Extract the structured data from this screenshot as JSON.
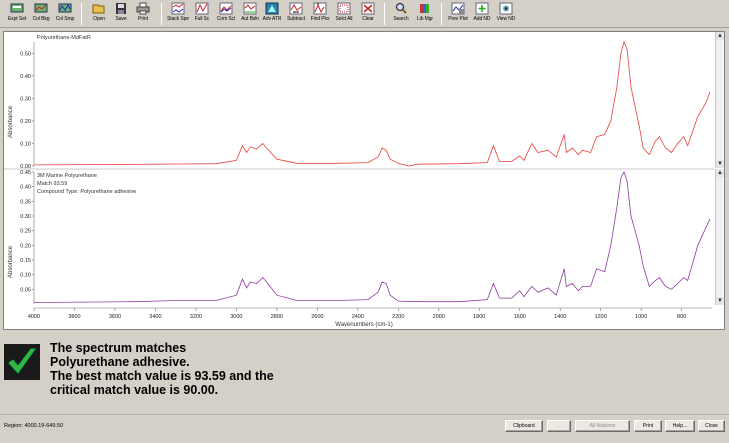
{
  "toolbar": {
    "buttons": [
      {
        "label": "Expt Set",
        "icon": "expt-set-icon"
      },
      {
        "label": "Col Bkg",
        "icon": "collect-background-icon"
      },
      {
        "label": "Col Smp",
        "icon": "collect-sample-icon"
      },
      {
        "label": "Open",
        "icon": "open-folder-icon"
      },
      {
        "label": "Save",
        "icon": "save-disk-icon"
      },
      {
        "label": "Print",
        "icon": "printer-icon"
      },
      {
        "label": "Stack Spe",
        "icon": "stack-spectra-icon"
      },
      {
        "label": "Full Sc",
        "icon": "full-scale-icon"
      },
      {
        "label": "Com Scl",
        "icon": "common-scale-icon"
      },
      {
        "label": "Aut Bsln",
        "icon": "auto-baseline-icon"
      },
      {
        "label": "Adv ATR",
        "icon": "advanced-atr-icon"
      },
      {
        "label": "Subtract",
        "icon": "subtract-icon"
      },
      {
        "label": "Find Pks",
        "icon": "find-peaks-icon"
      },
      {
        "label": "Selct All",
        "icon": "select-all-icon"
      },
      {
        "label": "Clear",
        "icon": "clear-icon"
      },
      {
        "label": "Search",
        "icon": "search-icon"
      },
      {
        "label": "Lib Mgr",
        "icon": "library-manager-icon"
      },
      {
        "label": "Prev Plot",
        "icon": "preview-plot-icon"
      },
      {
        "label": "Add ND",
        "icon": "add-nd-icon"
      },
      {
        "label": "View ND",
        "icon": "view-nd-icon"
      }
    ]
  },
  "plot": {
    "upper_label": "Polyurethane-MdFatR",
    "lower_label": "3M Marine Polyurethane",
    "match_line": "Match 93.59",
    "compound_line": "Compound Type:  Polyurethane adhesive",
    "y_axis_label": "Absorbance",
    "x_axis_label": "Wavenumbers (cm-1)",
    "upper_color": "#e8423c",
    "lower_color": "#8e3aa0"
  },
  "chart_data": [
    {
      "type": "line",
      "title": "Polyurethane-MdFatR",
      "xlabel": "Wavenumbers (cm-1)",
      "ylabel": "Absorbance",
      "xlim": [
        4000,
        650
      ],
      "ylim": [
        0,
        0.55
      ],
      "yticks": [
        "0.00",
        "0.10",
        "0.20",
        "0.30",
        "0.40",
        "0.50"
      ],
      "series": [
        {
          "name": "Polyurethane-MdFatR",
          "color": "#e8423c",
          "points": [
            [
              4000,
              0.005
            ],
            [
              3500,
              0.007
            ],
            [
              3400,
              0.008
            ],
            [
              3300,
              0.009
            ],
            [
              3100,
              0.01
            ],
            [
              3000,
              0.025
            ],
            [
              2970,
              0.09
            ],
            [
              2950,
              0.06
            ],
            [
              2930,
              0.085
            ],
            [
              2900,
              0.075
            ],
            [
              2870,
              0.1
            ],
            [
              2850,
              0.08
            ],
            [
              2800,
              0.03
            ],
            [
              2700,
              0.012
            ],
            [
              2500,
              0.012
            ],
            [
              2350,
              0.015
            ],
            [
              2300,
              0.04
            ],
            [
              2280,
              0.08
            ],
            [
              2260,
              0.07
            ],
            [
              2240,
              0.03
            ],
            [
              2200,
              0.012
            ],
            [
              2150,
              0.0
            ],
            [
              2100,
              0.008
            ],
            [
              1900,
              0.01
            ],
            [
              1760,
              0.015
            ],
            [
              1730,
              0.09
            ],
            [
              1700,
              0.02
            ],
            [
              1640,
              0.02
            ],
            [
              1600,
              0.045
            ],
            [
              1580,
              0.025
            ],
            [
              1540,
              0.1
            ],
            [
              1510,
              0.06
            ],
            [
              1460,
              0.07
            ],
            [
              1420,
              0.04
            ],
            [
              1380,
              0.14
            ],
            [
              1370,
              0.06
            ],
            [
              1340,
              0.08
            ],
            [
              1310,
              0.05
            ],
            [
              1290,
              0.07
            ],
            [
              1250,
              0.06
            ],
            [
              1220,
              0.13
            ],
            [
              1180,
              0.14
            ],
            [
              1150,
              0.2
            ],
            [
              1120,
              0.35
            ],
            [
              1100,
              0.5
            ],
            [
              1085,
              0.55
            ],
            [
              1070,
              0.52
            ],
            [
              1050,
              0.35
            ],
            [
              1010,
              0.18
            ],
            [
              990,
              0.08
            ],
            [
              960,
              0.05
            ],
            [
              930,
              0.11
            ],
            [
              910,
              0.13
            ],
            [
              880,
              0.08
            ],
            [
              850,
              0.06
            ],
            [
              820,
              0.1
            ],
            [
              790,
              0.13
            ],
            [
              770,
              0.09
            ],
            [
              720,
              0.22
            ],
            [
              680,
              0.28
            ],
            [
              660,
              0.33
            ]
          ]
        }
      ]
    },
    {
      "type": "line",
      "title": "3M Marine Polyurethane",
      "xlabel": "Wavenumbers (cm-1)",
      "ylabel": "Absorbance",
      "xlim": [
        4000,
        650
      ],
      "ylim": [
        0,
        0.45
      ],
      "yticks": [
        "0.05",
        "0.10",
        "0.15",
        "0.20",
        "0.25",
        "0.30",
        "0.35",
        "0.40",
        "0.45"
      ],
      "series": [
        {
          "name": "3M Marine Polyurethane",
          "color": "#8e3aa0",
          "points": [
            [
              4000,
              0.005
            ],
            [
              3500,
              0.008
            ],
            [
              3400,
              0.01
            ],
            [
              3300,
              0.012
            ],
            [
              3100,
              0.012
            ],
            [
              3000,
              0.03
            ],
            [
              2970,
              0.085
            ],
            [
              2950,
              0.055
            ],
            [
              2930,
              0.075
            ],
            [
              2900,
              0.07
            ],
            [
              2870,
              0.09
            ],
            [
              2850,
              0.075
            ],
            [
              2800,
              0.03
            ],
            [
              2700,
              0.012
            ],
            [
              2500,
              0.012
            ],
            [
              2350,
              0.015
            ],
            [
              2300,
              0.04
            ],
            [
              2280,
              0.075
            ],
            [
              2260,
              0.07
            ],
            [
              2240,
              0.03
            ],
            [
              2200,
              0.01
            ],
            [
              2100,
              0.008
            ],
            [
              1900,
              0.008
            ],
            [
              1760,
              0.015
            ],
            [
              1730,
              0.07
            ],
            [
              1700,
              0.02
            ],
            [
              1640,
              0.02
            ],
            [
              1600,
              0.045
            ],
            [
              1580,
              0.025
            ],
            [
              1540,
              0.06
            ],
            [
              1510,
              0.04
            ],
            [
              1460,
              0.055
            ],
            [
              1420,
              0.03
            ],
            [
              1380,
              0.12
            ],
            [
              1370,
              0.06
            ],
            [
              1340,
              0.07
            ],
            [
              1310,
              0.045
            ],
            [
              1290,
              0.06
            ],
            [
              1250,
              0.06
            ],
            [
              1220,
              0.12
            ],
            [
              1180,
              0.11
            ],
            [
              1150,
              0.2
            ],
            [
              1120,
              0.33
            ],
            [
              1100,
              0.43
            ],
            [
              1085,
              0.45
            ],
            [
              1070,
              0.42
            ],
            [
              1050,
              0.3
            ],
            [
              1010,
              0.2
            ],
            [
              990,
              0.13
            ],
            [
              960,
              0.06
            ],
            [
              930,
              0.08
            ],
            [
              910,
              0.09
            ],
            [
              880,
              0.06
            ],
            [
              850,
              0.05
            ],
            [
              820,
              0.07
            ],
            [
              790,
              0.09
            ],
            [
              770,
              0.08
            ],
            [
              720,
              0.2
            ],
            [
              680,
              0.26
            ],
            [
              660,
              0.29
            ]
          ]
        }
      ]
    }
  ],
  "x_ticks": [
    "4000",
    "3800",
    "3600",
    "3400",
    "3200",
    "3000",
    "2800",
    "2600",
    "2400",
    "2200",
    "2000",
    "1800",
    "1600",
    "1400",
    "1200",
    "1000",
    "800"
  ],
  "result": {
    "icon": "checkmark-icon",
    "lines": [
      "The spectrum matches",
      "Polyurethane adhesive.",
      "The best match value is 93.59 and the",
      "critical match value is 90.00."
    ]
  },
  "status": {
    "region": "Region:  4000.19-649.50",
    "buttons": [
      {
        "label": "Clipboard",
        "enabled": true
      },
      {
        "label": "...",
        "enabled": false
      },
      {
        "label": "All Matches",
        "enabled": false
      },
      {
        "label": "Print",
        "enabled": true
      },
      {
        "label": "Help...",
        "enabled": true
      },
      {
        "label": "Close",
        "enabled": true
      }
    ]
  }
}
